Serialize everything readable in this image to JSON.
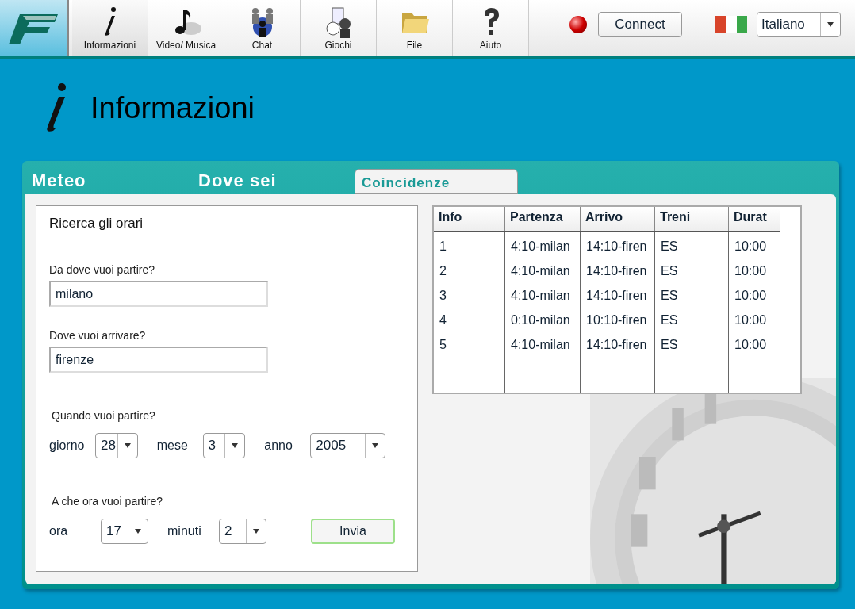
{
  "toolbar": {
    "items": [
      {
        "kind": "info",
        "label": "Informazioni",
        "selected": true
      },
      {
        "kind": "music",
        "label": "Video/ Musica",
        "selected": false
      },
      {
        "kind": "chat",
        "label": "Chat",
        "selected": false
      },
      {
        "kind": "games",
        "label": "Giochi",
        "selected": false
      },
      {
        "kind": "folder",
        "label": "File",
        "selected": false
      },
      {
        "kind": "help",
        "label": "Aiuto",
        "selected": false
      }
    ],
    "status_on": false,
    "connect_button": "Connect",
    "language": "Italiano"
  },
  "page_title": "Informazioni",
  "tabs": [
    {
      "label": "Meteo",
      "selected": false
    },
    {
      "label": "Dove sei",
      "selected": false
    },
    {
      "label": "Coincidenze",
      "selected": true
    }
  ],
  "form": {
    "title": "Ricerca gli orari",
    "from_label": "Da dove vuoi partire?",
    "from_value": "milano",
    "to_label": "Dove vuoi arrivare?",
    "to_value": "firenze",
    "date_label": "Quando vuoi partire?",
    "date_fields": [
      {
        "label": "giorno",
        "value": "28"
      },
      {
        "label": "mese",
        "value": "3"
      },
      {
        "label": "anno",
        "value": "2005"
      }
    ],
    "time_label": "A che ora vuoi partire?",
    "time_fields": [
      {
        "label": "ora",
        "value": "17"
      },
      {
        "label": "minuti",
        "value": "2"
      }
    ],
    "submit_button": "Invia"
  },
  "table": {
    "columns": [
      "Info",
      "Partenza",
      "Arrivo",
      "Treni",
      "Durat"
    ],
    "rows": [
      [
        "1",
        "4:10-milan",
        "14:10-firen",
        "ES",
        "10:00"
      ],
      [
        "2",
        "4:10-milan",
        "14:10-firen",
        "ES",
        "10:00"
      ],
      [
        "3",
        "4:10-milan",
        "14:10-firen",
        "ES",
        "10:00"
      ],
      [
        "4",
        "0:10-milan",
        "10:10-firen",
        "ES",
        "10:00"
      ],
      [
        "5",
        "4:10-milan",
        "14:10-firen",
        "ES",
        "10:00"
      ]
    ]
  }
}
